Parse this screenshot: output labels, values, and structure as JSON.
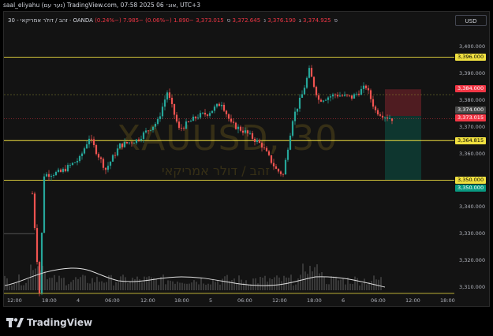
{
  "header": {
    "author_line": "saal_eliyahu (נער עם) TradingView.com, 07:58 2025 אוג׳ 06, UTC+3",
    "ohlc_line": {
      "symbol": "30 - זהב / דולר אמריקאי · OANDA",
      "o_label": "פ",
      "o": "3,374.925",
      "h_label": "ג",
      "h": "3,376.190",
      "l_label": "נ",
      "l": "3,372.645",
      "c_label": "ס",
      "c": "3,373.015",
      "chg": "−1.890 (−0.06%)",
      "chg2": "−7.985 (−0.24%)"
    },
    "currency": "USD"
  },
  "watermark": {
    "main": "XAUUSD, 30",
    "sub": "זהב / דולר אמריקאי"
  },
  "price_axis": {
    "ticks": [
      "3,400.000",
      "3,390.000",
      "3,380.000",
      "3,370.000",
      "3,360.000",
      "3,350.000",
      "3,340.000",
      "3,330.000",
      "3,320.000",
      "3,310.000"
    ],
    "tags": {
      "level_top": "3,396.000",
      "stop": "3,384.000",
      "entry": "3,374.000",
      "last": "3,373.015",
      "level_mid": "3,364.815",
      "level_low": "3,350.000",
      "target": "3,350.000"
    }
  },
  "time_axis": {
    "ticks": [
      "12:00",
      "18:00",
      "4",
      "06:00",
      "12:00",
      "18:00",
      "5",
      "06:00",
      "12:00",
      "18:00",
      "6",
      "06:00",
      "12:00",
      "18:00"
    ]
  },
  "colors": {
    "up": "#26a69a",
    "down": "#ef5350",
    "level": "#f0e040",
    "stop_zone": "#5a1f24",
    "target_zone": "#0e3b33"
  },
  "footer": {
    "logo_text": "TradingView"
  }
}
